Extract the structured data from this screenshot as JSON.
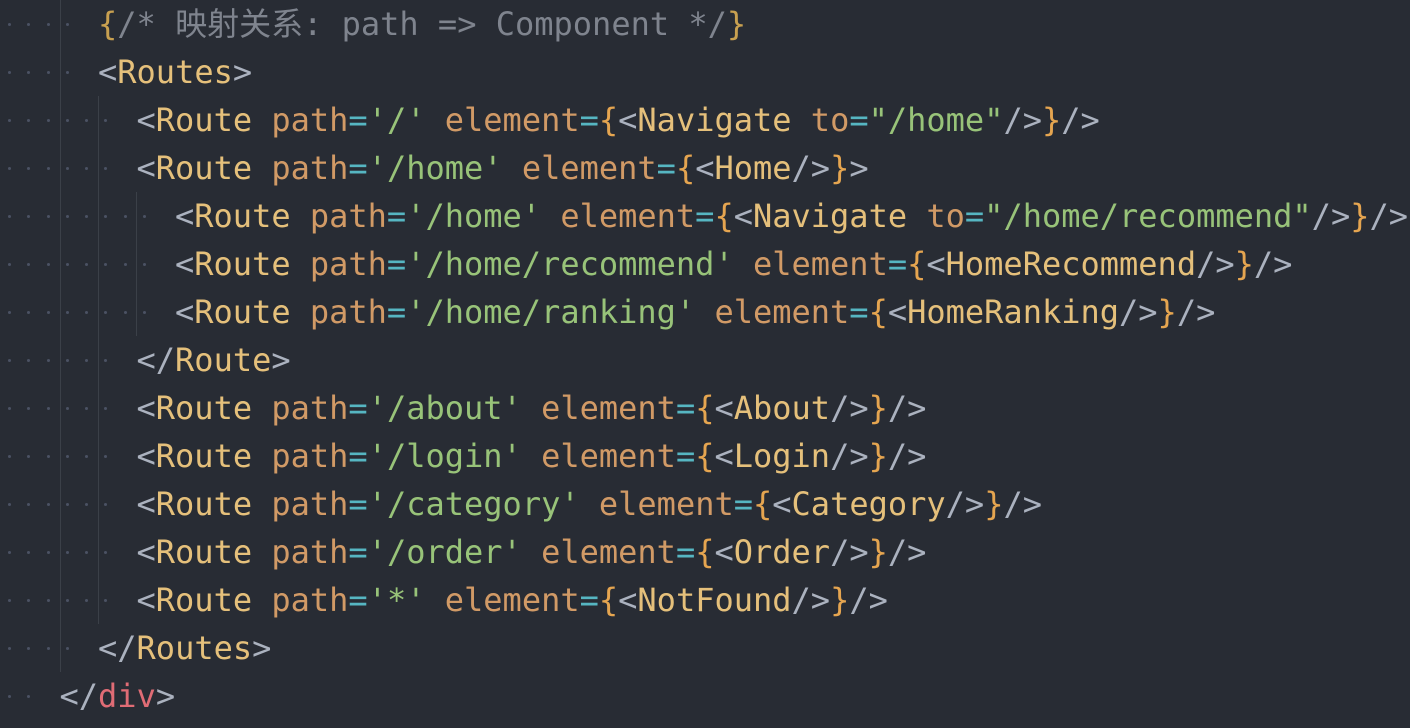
{
  "editor": {
    "lines": [
      {
        "indent": 2,
        "tokens": [
          [
            "commentbrace",
            "{"
          ],
          [
            "comment",
            "/* 映射关系: path => Component */"
          ],
          [
            "commentbrace",
            "}"
          ]
        ]
      },
      {
        "indent": 2,
        "tokens": [
          [
            "punct",
            "<"
          ],
          [
            "tag",
            "Routes"
          ],
          [
            "punct",
            ">"
          ]
        ]
      },
      {
        "indent": 3,
        "tokens": [
          [
            "punct",
            "<"
          ],
          [
            "tag",
            "Route"
          ],
          [
            "punct",
            " "
          ],
          [
            "attr",
            "path"
          ],
          [
            "eq",
            "="
          ],
          [
            "str",
            "'/'"
          ],
          [
            "punct",
            " "
          ],
          [
            "attr",
            "element"
          ],
          [
            "eq",
            "="
          ],
          [
            "brace",
            "{"
          ],
          [
            "punct",
            "<"
          ],
          [
            "tag",
            "Navigate"
          ],
          [
            "punct",
            " "
          ],
          [
            "attr",
            "to"
          ],
          [
            "eq",
            "="
          ],
          [
            "str",
            "\"/home\""
          ],
          [
            "punct",
            "/>"
          ],
          [
            "brace",
            "}"
          ],
          [
            "punct",
            "/>"
          ]
        ]
      },
      {
        "indent": 3,
        "tokens": [
          [
            "punct",
            "<"
          ],
          [
            "tag",
            "Route"
          ],
          [
            "punct",
            " "
          ],
          [
            "attr",
            "path"
          ],
          [
            "eq",
            "="
          ],
          [
            "str",
            "'/home'"
          ],
          [
            "punct",
            " "
          ],
          [
            "attr",
            "element"
          ],
          [
            "eq",
            "="
          ],
          [
            "brace",
            "{"
          ],
          [
            "punct",
            "<"
          ],
          [
            "tag",
            "Home"
          ],
          [
            "punct",
            "/>"
          ],
          [
            "brace",
            "}"
          ],
          [
            "punct",
            ">"
          ]
        ]
      },
      {
        "indent": 4,
        "tokens": [
          [
            "punct",
            "<"
          ],
          [
            "tag",
            "Route"
          ],
          [
            "punct",
            " "
          ],
          [
            "attr",
            "path"
          ],
          [
            "eq",
            "="
          ],
          [
            "str",
            "'/home'"
          ],
          [
            "punct",
            " "
          ],
          [
            "attr",
            "element"
          ],
          [
            "eq",
            "="
          ],
          [
            "brace",
            "{"
          ],
          [
            "punct",
            "<"
          ],
          [
            "tag",
            "Navigate"
          ],
          [
            "punct",
            " "
          ],
          [
            "attr",
            "to"
          ],
          [
            "eq",
            "="
          ],
          [
            "str",
            "\"/home/recommend\""
          ],
          [
            "punct",
            "/>"
          ],
          [
            "brace",
            "}"
          ],
          [
            "punct",
            "/>"
          ]
        ]
      },
      {
        "indent": 4,
        "tokens": [
          [
            "punct",
            "<"
          ],
          [
            "tag",
            "Route"
          ],
          [
            "punct",
            " "
          ],
          [
            "attr",
            "path"
          ],
          [
            "eq",
            "="
          ],
          [
            "str",
            "'/home/recommend'"
          ],
          [
            "punct",
            " "
          ],
          [
            "attr",
            "element"
          ],
          [
            "eq",
            "="
          ],
          [
            "brace",
            "{"
          ],
          [
            "punct",
            "<"
          ],
          [
            "tag",
            "HomeRecommend"
          ],
          [
            "punct",
            "/>"
          ],
          [
            "brace",
            "}"
          ],
          [
            "punct",
            "/>"
          ]
        ]
      },
      {
        "indent": 4,
        "tokens": [
          [
            "punct",
            "<"
          ],
          [
            "tag",
            "Route"
          ],
          [
            "punct",
            " "
          ],
          [
            "attr",
            "path"
          ],
          [
            "eq",
            "="
          ],
          [
            "str",
            "'/home/ranking'"
          ],
          [
            "punct",
            " "
          ],
          [
            "attr",
            "element"
          ],
          [
            "eq",
            "="
          ],
          [
            "brace",
            "{"
          ],
          [
            "punct",
            "<"
          ],
          [
            "tag",
            "HomeRanking"
          ],
          [
            "punct",
            "/>"
          ],
          [
            "brace",
            "}"
          ],
          [
            "punct",
            "/>"
          ]
        ]
      },
      {
        "indent": 3,
        "tokens": [
          [
            "punct",
            "</"
          ],
          [
            "tag",
            "Route"
          ],
          [
            "punct",
            ">"
          ]
        ]
      },
      {
        "indent": 3,
        "tokens": [
          [
            "punct",
            "<"
          ],
          [
            "tag",
            "Route"
          ],
          [
            "punct",
            " "
          ],
          [
            "attr",
            "path"
          ],
          [
            "eq",
            "="
          ],
          [
            "str",
            "'/about'"
          ],
          [
            "punct",
            " "
          ],
          [
            "attr",
            "element"
          ],
          [
            "eq",
            "="
          ],
          [
            "brace",
            "{"
          ],
          [
            "punct",
            "<"
          ],
          [
            "tag",
            "About"
          ],
          [
            "punct",
            "/>"
          ],
          [
            "brace",
            "}"
          ],
          [
            "punct",
            "/>"
          ]
        ]
      },
      {
        "indent": 3,
        "tokens": [
          [
            "punct",
            "<"
          ],
          [
            "tag",
            "Route"
          ],
          [
            "punct",
            " "
          ],
          [
            "attr",
            "path"
          ],
          [
            "eq",
            "="
          ],
          [
            "str",
            "'/login'"
          ],
          [
            "punct",
            " "
          ],
          [
            "attr",
            "element"
          ],
          [
            "eq",
            "="
          ],
          [
            "brace",
            "{"
          ],
          [
            "punct",
            "<"
          ],
          [
            "tag",
            "Login"
          ],
          [
            "punct",
            "/>"
          ],
          [
            "brace",
            "}"
          ],
          [
            "punct",
            "/>"
          ]
        ]
      },
      {
        "indent": 3,
        "tokens": [
          [
            "punct",
            "<"
          ],
          [
            "tag",
            "Route"
          ],
          [
            "punct",
            " "
          ],
          [
            "attr",
            "path"
          ],
          [
            "eq",
            "="
          ],
          [
            "str",
            "'/category'"
          ],
          [
            "punct",
            " "
          ],
          [
            "attr",
            "element"
          ],
          [
            "eq",
            "="
          ],
          [
            "brace",
            "{"
          ],
          [
            "punct",
            "<"
          ],
          [
            "tag",
            "Category"
          ],
          [
            "punct",
            "/>"
          ],
          [
            "brace",
            "}"
          ],
          [
            "punct",
            "/>"
          ]
        ]
      },
      {
        "indent": 3,
        "tokens": [
          [
            "punct",
            "<"
          ],
          [
            "tag",
            "Route"
          ],
          [
            "punct",
            " "
          ],
          [
            "attr",
            "path"
          ],
          [
            "eq",
            "="
          ],
          [
            "str",
            "'/order'"
          ],
          [
            "punct",
            " "
          ],
          [
            "attr",
            "element"
          ],
          [
            "eq",
            "="
          ],
          [
            "brace",
            "{"
          ],
          [
            "punct",
            "<"
          ],
          [
            "tag",
            "Order"
          ],
          [
            "punct",
            "/>"
          ],
          [
            "brace",
            "}"
          ],
          [
            "punct",
            "/>"
          ]
        ]
      },
      {
        "indent": 3,
        "tokens": [
          [
            "punct",
            "<"
          ],
          [
            "tag",
            "Route"
          ],
          [
            "punct",
            " "
          ],
          [
            "attr",
            "path"
          ],
          [
            "eq",
            "="
          ],
          [
            "str",
            "'*'"
          ],
          [
            "punct",
            " "
          ],
          [
            "attr",
            "element"
          ],
          [
            "eq",
            "="
          ],
          [
            "brace",
            "{"
          ],
          [
            "punct",
            "<"
          ],
          [
            "tag",
            "NotFound"
          ],
          [
            "punct",
            "/>"
          ],
          [
            "brace",
            "}"
          ],
          [
            "punct",
            "/>"
          ]
        ]
      },
      {
        "indent": 2,
        "tokens": [
          [
            "punct",
            "</"
          ],
          [
            "tag",
            "Routes"
          ],
          [
            "punct",
            ">"
          ]
        ]
      },
      {
        "indent": 1,
        "tokens": [
          [
            "punct",
            "</"
          ],
          [
            "html",
            "div"
          ],
          [
            "punct",
            ">"
          ]
        ]
      }
    ]
  }
}
